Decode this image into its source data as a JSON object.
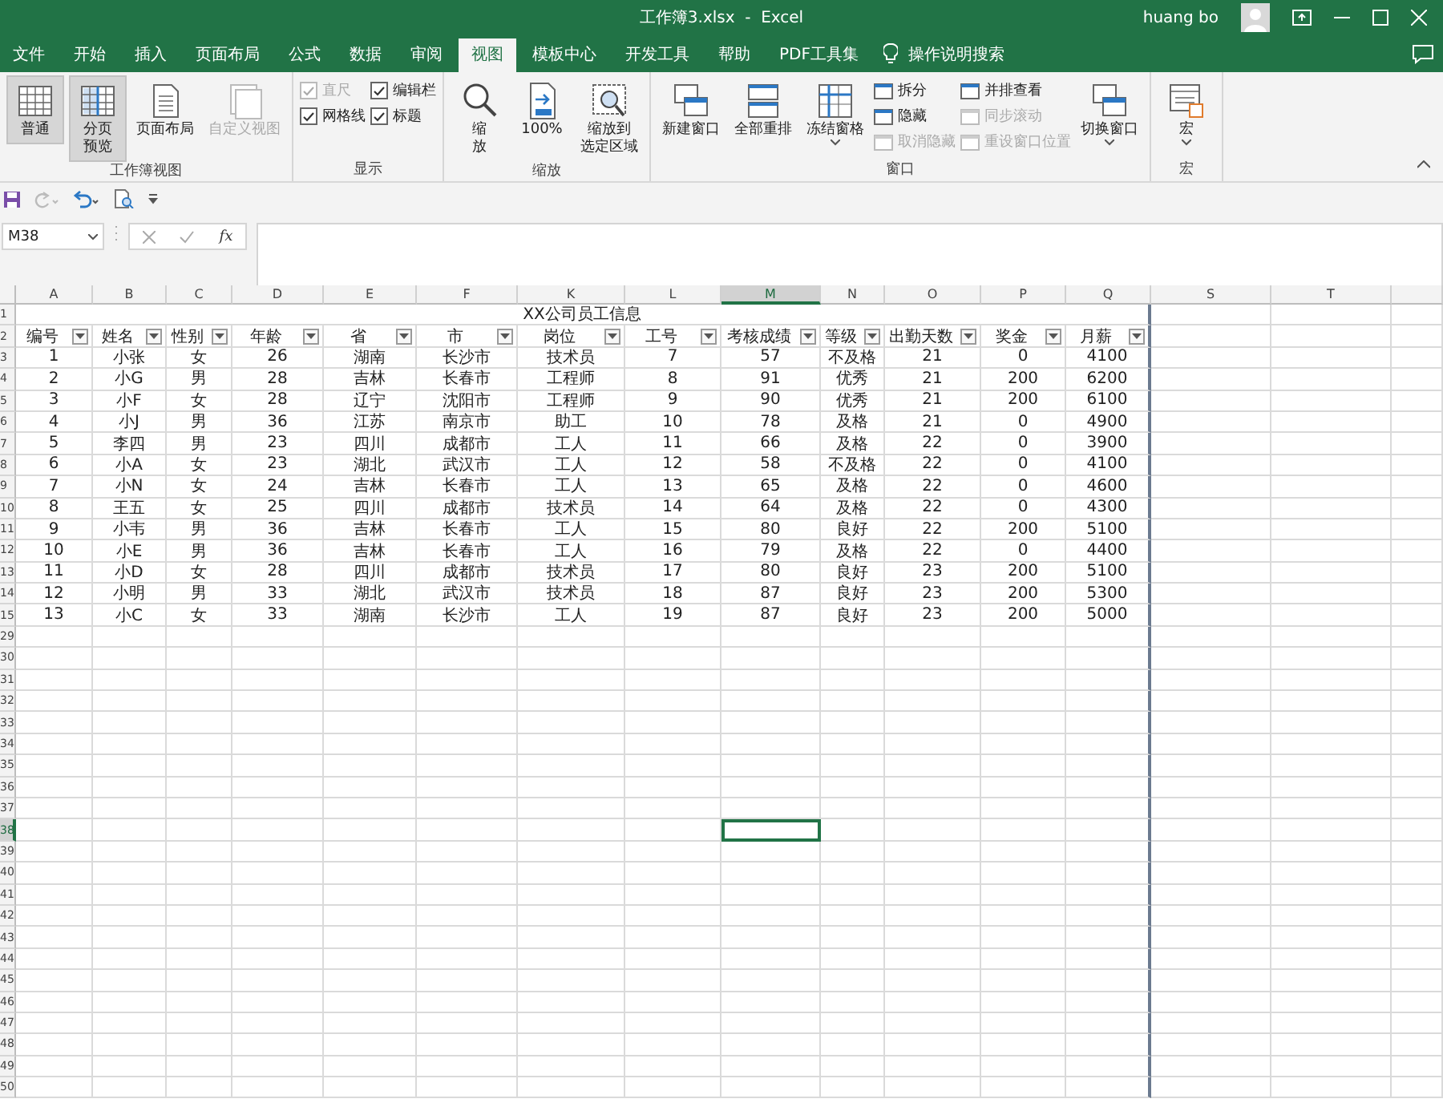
{
  "window": {
    "title": "工作簿3.xlsx  -  Excel",
    "user": "huang bo"
  },
  "tabs": [
    {
      "label": "文件",
      "selected": false
    },
    {
      "label": "开始",
      "selected": false
    },
    {
      "label": "插入",
      "selected": false
    },
    {
      "label": "页面布局",
      "selected": false
    },
    {
      "label": "公式",
      "selected": false
    },
    {
      "label": "数据",
      "selected": false
    },
    {
      "label": "审阅",
      "selected": false
    },
    {
      "label": "视图",
      "selected": true
    },
    {
      "label": "模板中心",
      "selected": false
    },
    {
      "label": "开发工具",
      "selected": false
    },
    {
      "label": "帮助",
      "selected": false
    },
    {
      "label": "PDF工具集",
      "selected": false
    }
  ],
  "tell_me": "操作说明搜索",
  "ribbon": [
    {
      "label": "工作簿视图",
      "items": [
        {
          "kind": "big",
          "label_lines": [
            "普通"
          ],
          "selected": true,
          "disabled": false,
          "has_menu": false
        },
        {
          "kind": "big",
          "label_lines": [
            "分页",
            "预览"
          ],
          "selected": true,
          "disabled": false,
          "has_menu": false
        },
        {
          "kind": "big",
          "label_lines": [
            "页面布局"
          ],
          "selected": false,
          "disabled": false,
          "has_menu": false
        },
        {
          "kind": "big",
          "label_lines": [
            "自定义视图"
          ],
          "selected": false,
          "disabled": true,
          "has_menu": false
        }
      ]
    },
    {
      "label": "显示",
      "items": [
        {
          "kind": "stack",
          "entries": [
            {
              "kind": "check",
              "label": "直尺",
              "checked": true,
              "disabled": true
            },
            {
              "kind": "check",
              "label": "网格线",
              "checked": true,
              "disabled": false
            }
          ]
        },
        {
          "kind": "stack",
          "entries": [
            {
              "kind": "check",
              "label": "编辑栏",
              "checked": true,
              "disabled": false
            },
            {
              "kind": "check",
              "label": "标题",
              "checked": true,
              "disabled": false
            }
          ]
        }
      ]
    },
    {
      "label": "缩放",
      "items": [
        {
          "kind": "big",
          "label_lines": [
            "缩",
            "放"
          ],
          "selected": false,
          "disabled": false,
          "has_menu": false
        },
        {
          "kind": "big",
          "label_lines": [
            "100%"
          ],
          "selected": false,
          "disabled": false,
          "has_menu": false
        },
        {
          "kind": "big",
          "label_lines": [
            "缩放到",
            "选定区域"
          ],
          "selected": false,
          "disabled": false,
          "has_menu": false
        }
      ]
    },
    {
      "label": "窗口",
      "items": [
        {
          "kind": "big",
          "label_lines": [
            "新建窗口"
          ],
          "selected": false,
          "disabled": false,
          "has_menu": false
        },
        {
          "kind": "big",
          "label_lines": [
            "全部重排"
          ],
          "selected": false,
          "disabled": false,
          "has_menu": false
        },
        {
          "kind": "big",
          "label_lines": [
            "冻结窗格"
          ],
          "selected": false,
          "disabled": false,
          "has_menu": true
        },
        {
          "kind": "stack",
          "entries": [
            {
              "kind": "small",
              "label": "拆分",
              "disabled": false
            },
            {
              "kind": "small",
              "label": "隐藏",
              "disabled": false
            },
            {
              "kind": "small",
              "label": "取消隐藏",
              "disabled": true
            }
          ]
        },
        {
          "kind": "stack",
          "entries": [
            {
              "kind": "small",
              "label": "并排查看",
              "disabled": false
            },
            {
              "kind": "small",
              "label": "同步滚动",
              "disabled": true
            },
            {
              "kind": "small",
              "label": "重设窗口位置",
              "disabled": true
            }
          ]
        },
        {
          "kind": "big",
          "label_lines": [
            "切换窗口"
          ],
          "selected": false,
          "disabled": false,
          "has_menu": true
        }
      ]
    },
    {
      "label": "宏",
      "items": [
        {
          "kind": "big",
          "label_lines": [
            "宏"
          ],
          "selected": false,
          "disabled": false,
          "has_menu": true
        }
      ]
    }
  ],
  "formula_bar": {
    "name_box": "M38",
    "fx": "fx"
  },
  "sheet": {
    "columns": [
      {
        "label": "A",
        "selected": false
      },
      {
        "label": "B",
        "selected": false
      },
      {
        "label": "C",
        "selected": false
      },
      {
        "label": "D",
        "selected": false
      },
      {
        "label": "E",
        "selected": false
      },
      {
        "label": "F",
        "selected": false
      },
      {
        "label": "K",
        "selected": false
      },
      {
        "label": "L",
        "selected": false
      },
      {
        "label": "M",
        "selected": true
      },
      {
        "label": "N",
        "selected": false
      },
      {
        "label": "O",
        "selected": false
      },
      {
        "label": "P",
        "selected": false
      },
      {
        "label": "Q",
        "selected": false
      },
      {
        "label": "S",
        "selected": false
      },
      {
        "label": "T",
        "selected": false
      }
    ],
    "title_row": {
      "label": "1",
      "title": "XX公司员工信息"
    },
    "header_row": {
      "label": "2",
      "cells": [
        "编号",
        "姓名",
        "性别",
        "年龄",
        "省",
        "市",
        "岗位",
        "工号",
        "考核成绩",
        "等级",
        "出勤天数",
        "奖金",
        "月薪"
      ]
    },
    "rows": [
      {
        "label": "3",
        "cells": [
          "1",
          "小张",
          "女",
          "26",
          "湖南",
          "长沙市",
          "技术员",
          "7",
          "57",
          "不及格",
          "21",
          "0",
          "4100"
        ]
      },
      {
        "label": "4",
        "cells": [
          "2",
          "小G",
          "男",
          "28",
          "吉林",
          "长春市",
          "工程师",
          "8",
          "91",
          "优秀",
          "21",
          "200",
          "6200"
        ]
      },
      {
        "label": "5",
        "cells": [
          "3",
          "小F",
          "女",
          "28",
          "辽宁",
          "沈阳市",
          "工程师",
          "9",
          "90",
          "优秀",
          "21",
          "200",
          "6100"
        ]
      },
      {
        "label": "6",
        "cells": [
          "4",
          "小J",
          "男",
          "36",
          "江苏",
          "南京市",
          "助工",
          "10",
          "78",
          "及格",
          "21",
          "0",
          "4900"
        ]
      },
      {
        "label": "7",
        "cells": [
          "5",
          "李四",
          "男",
          "23",
          "四川",
          "成都市",
          "工人",
          "11",
          "66",
          "及格",
          "22",
          "0",
          "3900"
        ]
      },
      {
        "label": "8",
        "cells": [
          "6",
          "小A",
          "女",
          "23",
          "湖北",
          "武汉市",
          "工人",
          "12",
          "58",
          "不及格",
          "22",
          "0",
          "4100"
        ]
      },
      {
        "label": "9",
        "cells": [
          "7",
          "小N",
          "女",
          "24",
          "吉林",
          "长春市",
          "工人",
          "13",
          "65",
          "及格",
          "22",
          "0",
          "4600"
        ]
      },
      {
        "label": "10",
        "cells": [
          "8",
          "王五",
          "女",
          "25",
          "四川",
          "成都市",
          "技术员",
          "14",
          "64",
          "及格",
          "22",
          "0",
          "4300"
        ]
      },
      {
        "label": "11",
        "cells": [
          "9",
          "小韦",
          "男",
          "36",
          "吉林",
          "长春市",
          "工人",
          "15",
          "80",
          "良好",
          "22",
          "200",
          "5100"
        ]
      },
      {
        "label": "12",
        "cells": [
          "10",
          "小E",
          "男",
          "36",
          "吉林",
          "长春市",
          "工人",
          "16",
          "79",
          "及格",
          "22",
          "0",
          "4400"
        ]
      },
      {
        "label": "13",
        "cells": [
          "11",
          "小D",
          "女",
          "28",
          "四川",
          "成都市",
          "技术员",
          "17",
          "80",
          "良好",
          "23",
          "200",
          "5100"
        ]
      },
      {
        "label": "14",
        "cells": [
          "12",
          "小明",
          "男",
          "33",
          "湖北",
          "武汉市",
          "技术员",
          "18",
          "87",
          "良好",
          "23",
          "200",
          "5300"
        ]
      },
      {
        "label": "15",
        "cells": [
          "13",
          "小C",
          "女",
          "33",
          "湖南",
          "长沙市",
          "工人",
          "19",
          "87",
          "良好",
          "23",
          "200",
          "5000"
        ]
      }
    ],
    "empty_rows": [
      {
        "label": "29",
        "active": false
      },
      {
        "label": "30",
        "active": false
      },
      {
        "label": "31",
        "active": false
      },
      {
        "label": "32",
        "active": false
      },
      {
        "label": "33",
        "active": false
      },
      {
        "label": "34",
        "active": false
      },
      {
        "label": "35",
        "active": false
      },
      {
        "label": "36",
        "active": false
      },
      {
        "label": "37",
        "active": false
      },
      {
        "label": "38",
        "active": true
      },
      {
        "label": "39",
        "active": false
      },
      {
        "label": "40",
        "active": false
      },
      {
        "label": "41",
        "active": false
      },
      {
        "label": "42",
        "active": false
      },
      {
        "label": "43",
        "active": false
      },
      {
        "label": "44",
        "active": false
      },
      {
        "label": "45",
        "active": false
      },
      {
        "label": "46",
        "active": false
      },
      {
        "label": "47",
        "active": false
      },
      {
        "label": "48",
        "active": false
      },
      {
        "label": "49",
        "active": false
      },
      {
        "label": "50",
        "active": false
      }
    ]
  }
}
